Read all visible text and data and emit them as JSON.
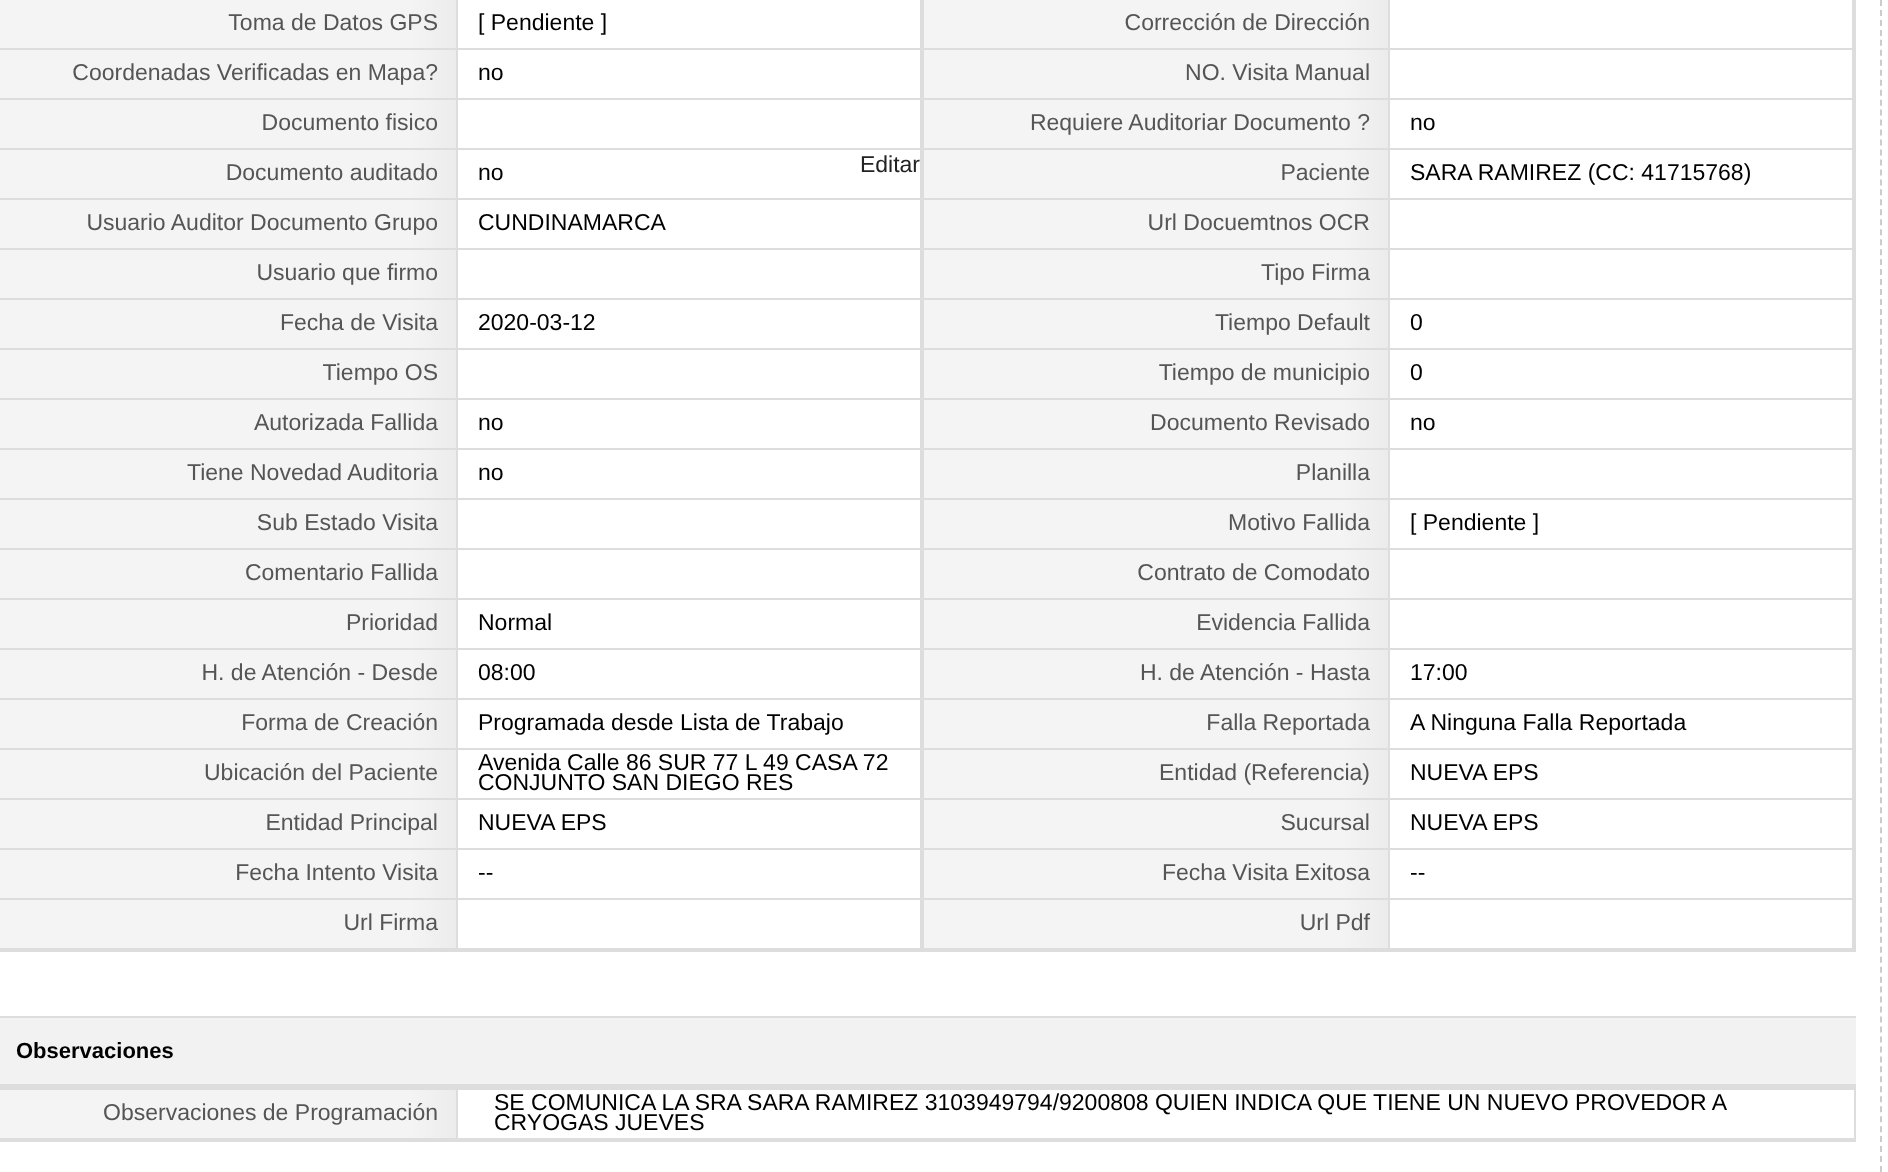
{
  "details": {
    "rows": [
      {
        "left": {
          "label": "Toma de Datos GPS",
          "value": "[ Pendiente ]"
        },
        "right": {
          "label": "Corrección de Dirección"
        }
      },
      {
        "left": {
          "label": "Coordenadas Verificadas en Mapa?",
          "value": "no"
        },
        "right": {
          "label": "NO. Visita Manual"
        }
      },
      {
        "left": {
          "label": "Documento fisico"
        },
        "right": {
          "label": "Requiere Auditoriar Documento ?",
          "value": "no"
        }
      },
      {
        "left": {
          "label": "Documento auditado",
          "value": "no",
          "link": "Editar"
        },
        "right": {
          "label": "Paciente",
          "value": "SARA RAMIREZ (CC: 41715768)"
        }
      },
      {
        "left": {
          "label": "Usuario Auditor Documento Grupo",
          "value": "CUNDINAMARCA"
        },
        "right": {
          "label": "Url Docuemtnos OCR"
        }
      },
      {
        "left": {
          "label": "Usuario que firmo"
        },
        "right": {
          "label": "Tipo Firma"
        }
      },
      {
        "left": {
          "label": "Fecha de Visita",
          "value": "2020-03-12"
        },
        "right": {
          "label": "Tiempo Default",
          "value": "0"
        }
      },
      {
        "left": {
          "label": "Tiempo OS"
        },
        "right": {
          "label": "Tiempo de municipio",
          "value": "0"
        }
      },
      {
        "left": {
          "label": "Autorizada Fallida",
          "value": "no"
        },
        "right": {
          "label": "Documento Revisado",
          "value": "no"
        }
      },
      {
        "left": {
          "label": "Tiene Novedad Auditoria",
          "value": "no"
        },
        "right": {
          "label": "Planilla"
        }
      },
      {
        "left": {
          "label": "Sub Estado Visita"
        },
        "right": {
          "label": "Motivo Fallida",
          "value": "[ Pendiente ]"
        }
      },
      {
        "left": {
          "label": "Comentario Fallida"
        },
        "right": {
          "label": "Contrato de Comodato"
        }
      },
      {
        "left": {
          "label": "Prioridad",
          "value": "Normal"
        },
        "right": {
          "label": "Evidencia Fallida"
        }
      },
      {
        "left": {
          "label": "H. de Atención - Desde",
          "value": "08:00"
        },
        "right": {
          "label": "H. de Atención - Hasta",
          "value": "17:00"
        }
      },
      {
        "left": {
          "label": "Forma de Creación",
          "value": "Programada desde Lista de Trabajo"
        },
        "right": {
          "label": "Falla Reportada",
          "value": "A Ninguna Falla Reportada"
        }
      },
      {
        "left": {
          "label": "Ubicación del Paciente",
          "value": "Avenida Calle 86 SUR 77 L 49 CASA 72 CONJUNTO SAN DIEGO RES"
        },
        "right": {
          "label": "Entidad (Referencia)",
          "value": "NUEVA EPS"
        }
      },
      {
        "left": {
          "label": "Entidad Principal",
          "value": "NUEVA EPS"
        },
        "right": {
          "label": "Sucursal",
          "value": "NUEVA EPS"
        }
      },
      {
        "left": {
          "label": "Fecha Intento Visita",
          "value": "--"
        },
        "right": {
          "label": "Fecha Visita Exitosa",
          "value": "--"
        }
      },
      {
        "left": {
          "label": "Url Firma"
        },
        "right": {
          "label": "Url Pdf"
        }
      }
    ]
  },
  "observations": {
    "title": "Observaciones",
    "label": "Observaciones de Programación",
    "value": "SE COMUNICA LA SRA SARA RAMIREZ 3103949794/9200808 QUIEN INDICA QUE TIENE UN NUEVO PROVEDOR A CRYOGAS JUEVES"
  }
}
